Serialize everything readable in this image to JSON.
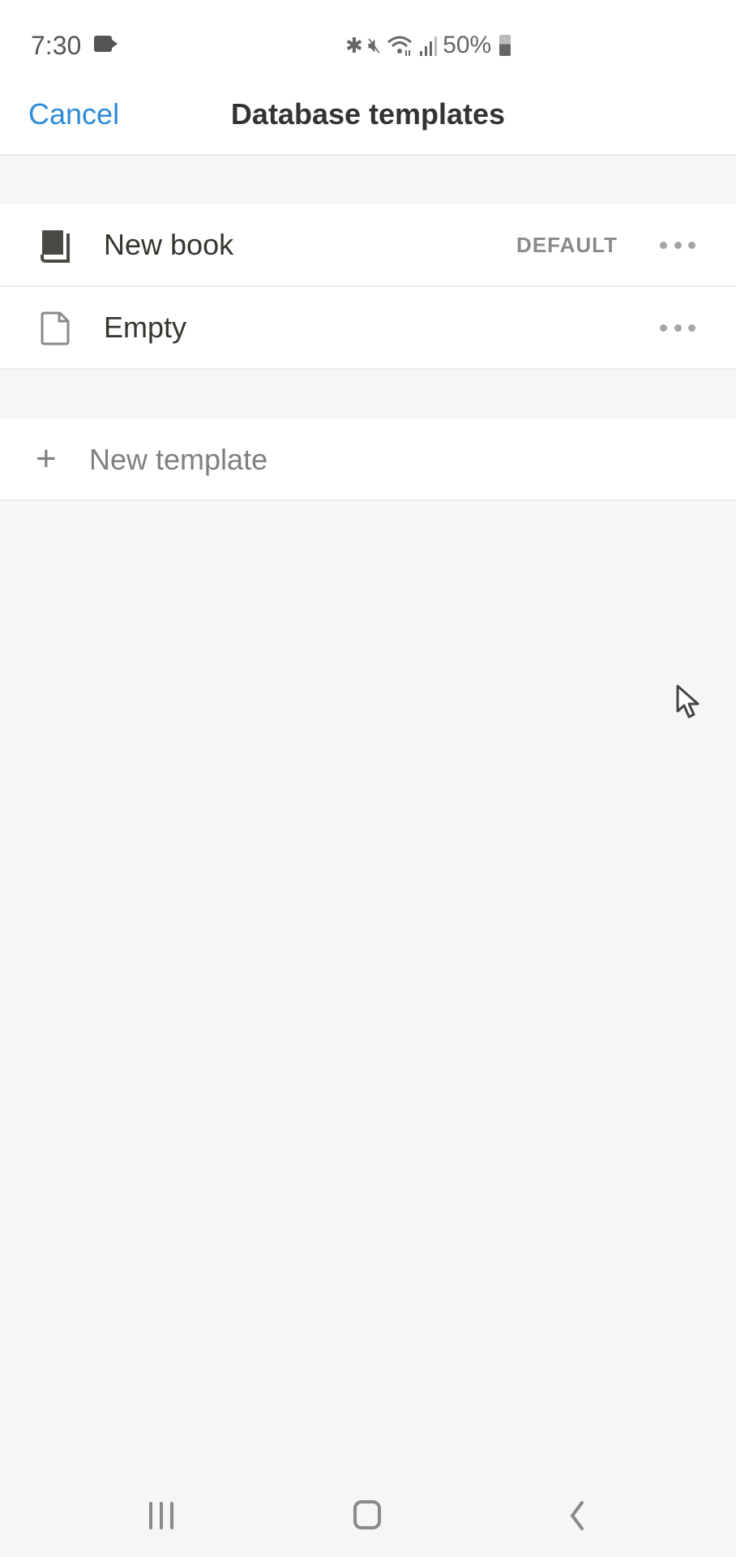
{
  "status_bar": {
    "time": "7:30",
    "recording_icon": "video-camera-icon",
    "icons": [
      "bluetooth-icon",
      "mute-icon",
      "wifi-icon",
      "signal-icon"
    ],
    "battery": "50%"
  },
  "header": {
    "cancel_label": "Cancel",
    "title": "Database templates"
  },
  "templates": [
    {
      "icon": "book-icon",
      "label": "New book",
      "badge": "DEFAULT",
      "more": "more-icon"
    },
    {
      "icon": "page-icon",
      "label": "Empty",
      "badge": "",
      "more": "more-icon"
    }
  ],
  "new_template": {
    "icon": "plus-icon",
    "label": "New template"
  },
  "colors": {
    "accent": "#2e8bd6",
    "background": "#f7f6f4",
    "text": "#37352f",
    "muted": "#808080"
  },
  "navbar": {
    "recent": "recent-apps-icon",
    "home": "home-icon",
    "back": "back-icon"
  }
}
